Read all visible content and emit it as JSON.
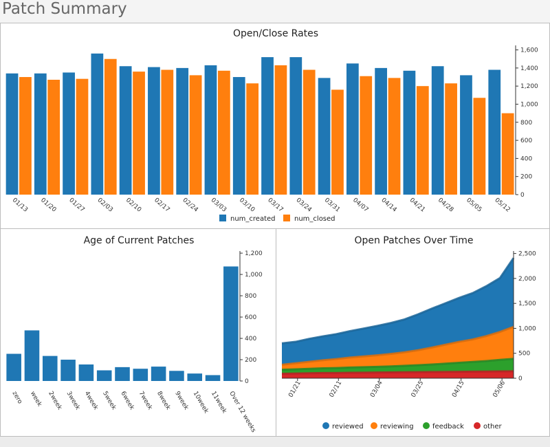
{
  "page": {
    "title": "Patch Summary"
  },
  "chart_data": [
    {
      "id": "open-close",
      "type": "bar",
      "title": "Open/Close Rates",
      "categories": [
        "01/13",
        "01/20",
        "01/27",
        "02/03",
        "02/10",
        "02/17",
        "02/24",
        "03/03",
        "03/10",
        "03/17",
        "03/24",
        "03/31",
        "04/07",
        "04/14",
        "04/21",
        "04/28",
        "05/05",
        "05/12"
      ],
      "series": [
        {
          "name": "num_created",
          "color": "#1f77b4",
          "values": [
            1340,
            1340,
            1350,
            1560,
            1420,
            1410,
            1400,
            1430,
            1300,
            1520,
            1520,
            1290,
            1450,
            1400,
            1370,
            1420,
            1320,
            1380
          ]
        },
        {
          "name": "num_closed",
          "color": "#ff7f0e",
          "values": [
            1300,
            1270,
            1280,
            1500,
            1360,
            1380,
            1320,
            1370,
            1230,
            1430,
            1380,
            1160,
            1310,
            1290,
            1200,
            1230,
            1070,
            900
          ]
        }
      ],
      "y_ticks": [
        0,
        200,
        400,
        600,
        800,
        1000,
        1200,
        1400,
        1600
      ],
      "y_tick_labels": [
        "0",
        "200",
        "400",
        "600",
        "800",
        "1,000",
        "1,200",
        "1,400",
        "1,600"
      ],
      "ylim": [
        0,
        1650
      ],
      "legend_position": "bottom"
    },
    {
      "id": "age",
      "type": "bar",
      "title": "Age of Current Patches",
      "categories": [
        "zero",
        "week",
        "2week",
        "3week",
        "4week",
        "5week",
        "6week",
        "7week",
        "8week",
        "9week",
        "10week",
        "11week",
        "Over 12 weeks"
      ],
      "values": [
        255,
        475,
        235,
        200,
        155,
        100,
        130,
        115,
        135,
        95,
        70,
        55,
        1075
      ],
      "color": "#1f77b4",
      "y_ticks": [
        0,
        200,
        400,
        600,
        800,
        1000,
        1200
      ],
      "y_tick_labels": [
        "0",
        "200",
        "400",
        "600",
        "800",
        "1,000",
        "1,200"
      ],
      "ylim": [
        0,
        1220
      ]
    },
    {
      "id": "open-over-time",
      "type": "area",
      "stacked": true,
      "title": "Open Patches Over Time",
      "x": [
        "01/13",
        "01/20",
        "01/27",
        "02/03",
        "02/10",
        "02/17",
        "02/24",
        "03/03",
        "03/10",
        "03/17",
        "03/24",
        "03/31",
        "04/07",
        "04/14",
        "04/21",
        "04/28",
        "05/05",
        "05/12"
      ],
      "x_tick_labels": [
        "01/21",
        "02/11",
        "03/04",
        "03/25",
        "04/15",
        "05/06"
      ],
      "series": [
        {
          "name": "other",
          "color": "#d62728",
          "values": [
            90,
            95,
            100,
            105,
            105,
            110,
            112,
            115,
            118,
            120,
            122,
            125,
            128,
            130,
            132,
            135,
            138,
            140
          ]
        },
        {
          "name": "feedback",
          "color": "#2ca02c",
          "values": [
            80,
            85,
            90,
            95,
            100,
            105,
            110,
            115,
            120,
            130,
            140,
            150,
            165,
            180,
            195,
            210,
            230,
            250
          ]
        },
        {
          "name": "reviewing",
          "color": "#ff7f0e",
          "values": [
            100,
            120,
            140,
            160,
            180,
            200,
            215,
            230,
            250,
            270,
            300,
            340,
            380,
            420,
            450,
            500,
            560,
            640
          ]
        },
        {
          "name": "reviewed",
          "color": "#1f77b4",
          "values": [
            430,
            430,
            460,
            480,
            500,
            530,
            560,
            590,
            620,
            660,
            720,
            780,
            830,
            880,
            930,
            1000,
            1080,
            1380
          ]
        }
      ],
      "y_ticks": [
        0,
        500,
        1000,
        1500,
        2000,
        2500
      ],
      "y_tick_labels": [
        "0",
        "500",
        "1,000",
        "1,500",
        "2,000",
        "2,500"
      ],
      "ylim": [
        0,
        2550
      ],
      "legend_order": [
        "reviewed",
        "reviewing",
        "feedback",
        "other"
      ],
      "legend_position": "bottom"
    }
  ]
}
